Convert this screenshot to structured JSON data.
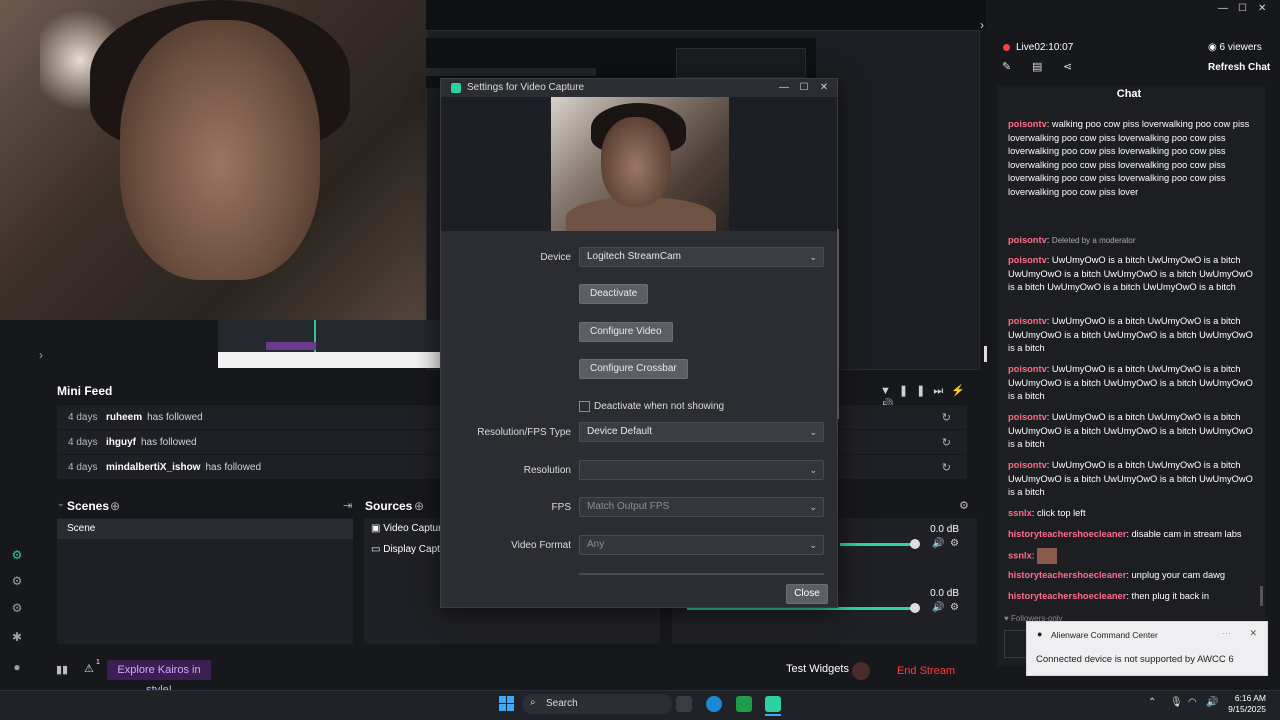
{
  "stream": {
    "live_label": "Live",
    "live_time": "02:10:07",
    "viewers": "6 viewers",
    "refresh_chat": "Refresh Chat"
  },
  "chat": {
    "title": "Chat",
    "messages": [
      {
        "user": "poisontv",
        "sep": ": ",
        "text": "walking poo cow piss loverwalking poo cow piss loverwalking poo cow piss loverwalking poo cow piss loverwalking poo cow piss loverwalking poo cow piss loverwalking poo cow piss loverwalking poo cow piss loverwalking poo cow piss loverwalking poo cow piss loverwalking poo cow piss lover"
      },
      {
        "user": "poisontv",
        "sep": ": ",
        "text": "Deleted by a moderator"
      },
      {
        "user": "poisontv",
        "sep": ": ",
        "text": "UwUmyOwO is a bitch UwUmyOwO is a bitch UwUmyOwO is a bitch UwUmyOwO is a bitch UwUmyOwO is a bitch UwUmyOwO is a bitch UwUmyOwO is a bitch"
      },
      {
        "user": "poisontv",
        "sep": ": ",
        "text": "UwUmyOwO is a bitch UwUmyOwO is a bitch UwUmyOwO is a bitch UwUmyOwO is a bitch UwUmyOwO is a bitch"
      },
      {
        "user": "poisontv",
        "sep": ": ",
        "text": "UwUmyOwO is a bitch UwUmyOwO is a bitch UwUmyOwO is a bitch UwUmyOwO is a bitch UwUmyOwO is a bitch"
      },
      {
        "user": "poisontv",
        "sep": ": ",
        "text": "UwUmyOwO is a bitch UwUmyOwO is a bitch UwUmyOwO is a bitch UwUmyOwO is a bitch UwUmyOwO is a bitch"
      },
      {
        "user": "poisontv",
        "sep": ": ",
        "text": "UwUmyOwO is a bitch UwUmyOwO is a bitch UwUmyOwO is a bitch UwUmyOwO is a bitch UwUmyOwO is a bitch"
      },
      {
        "user": "ssnlx",
        "sep": ": ",
        "text": "click top left"
      },
      {
        "user": "historyteachershoecleaner",
        "sep": ": ",
        "text": "disable cam in stream labs"
      },
      {
        "user": "ssnlx",
        "sep": ": ",
        "text": ""
      },
      {
        "user": "historyteachershoecleaner",
        "sep": ": ",
        "text": "unplug your cam dawg"
      },
      {
        "user": "historyteachershoecleaner",
        "sep": ": ",
        "text": "then plug it back in"
      }
    ],
    "followers_only": "Followers-only"
  },
  "dialog": {
    "title": "Settings for Video Capture",
    "device_label": "Device",
    "device_value": "Logitech StreamCam",
    "deactivate": "Deactivate",
    "configure_video": "Configure Video",
    "configure_crossbar": "Configure Crossbar",
    "deactivate_when_hidden": "Deactivate when not showing",
    "resfps_label": "Resolution/FPS Type",
    "resfps_value": "Device Default",
    "resolution_label": "Resolution",
    "resolution_value": "",
    "fps_label": "FPS",
    "fps_value": "Match Output FPS",
    "video_format_label": "Video Format",
    "video_format_value": "Any",
    "close": "Close"
  },
  "minifeed": {
    "title": "Mini Feed",
    "rows": [
      {
        "days": "4 days",
        "user": "ruheem",
        "action": "has followed"
      },
      {
        "days": "4 days",
        "user": "ihguyf",
        "action": "has followed"
      },
      {
        "days": "4 days",
        "user": "mindalbertiX_ishow",
        "action": "has followed"
      }
    ]
  },
  "scenes": {
    "title": "Scenes",
    "items": [
      "Scene"
    ]
  },
  "sources": {
    "title": "Sources",
    "items": [
      "Video Captur",
      "Display Captu"
    ]
  },
  "mixer": {
    "db1": "0.0 dB",
    "db2": "0.0 dB"
  },
  "bottom": {
    "explore": "Explore Kairos in style!",
    "test_widgets": "Test Widgets",
    "end_stream": "End Stream",
    "alert_count": "1"
  },
  "notification": {
    "app": "Alienware Command Center",
    "body": "Connected device is not supported by AWCC 6"
  },
  "taskbar": {
    "search": "Search",
    "time": "6:16 AM",
    "date": "9/15/2025"
  },
  "colors": {
    "accent_live": "#ff4040",
    "chat_username": "#ff6b8a",
    "end_stream": "#ff3b3b",
    "dialog_bg": "#2b2d33"
  }
}
